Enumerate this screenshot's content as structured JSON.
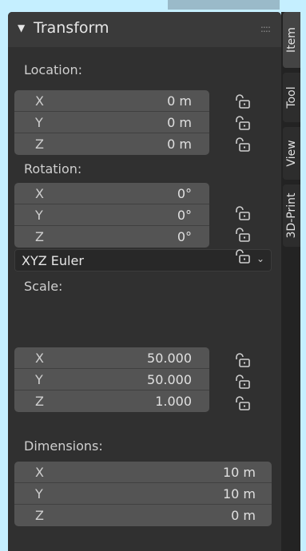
{
  "panel": {
    "title": "Transform",
    "grip": "::::"
  },
  "location": {
    "label": "Location:",
    "rows": [
      {
        "axis": "X",
        "value": "0 m"
      },
      {
        "axis": "Y",
        "value": "0 m"
      },
      {
        "axis": "Z",
        "value": "0 m"
      }
    ]
  },
  "rotation": {
    "label": "Rotation:",
    "rows": [
      {
        "axis": "X",
        "value": "0°"
      },
      {
        "axis": "Y",
        "value": "0°"
      },
      {
        "axis": "Z",
        "value": "0°"
      }
    ],
    "mode": "XYZ Euler"
  },
  "scale": {
    "label": "Scale:",
    "rows": [
      {
        "axis": "X",
        "value": "50.000"
      },
      {
        "axis": "Y",
        "value": "50.000"
      },
      {
        "axis": "Z",
        "value": "1.000"
      }
    ]
  },
  "dimensions": {
    "label": "Dimensions:",
    "rows": [
      {
        "axis": "X",
        "value": "10 m"
      },
      {
        "axis": "Y",
        "value": "10 m"
      },
      {
        "axis": "Z",
        "value": "0 m"
      }
    ]
  },
  "tabs": [
    {
      "label": "Item",
      "active": true
    },
    {
      "label": "Tool",
      "active": false
    },
    {
      "label": "View",
      "active": false
    },
    {
      "label": "3D-Print",
      "active": false
    }
  ],
  "colors": {
    "background": "#c5efff",
    "panel": "#303030",
    "field": "#545454"
  }
}
